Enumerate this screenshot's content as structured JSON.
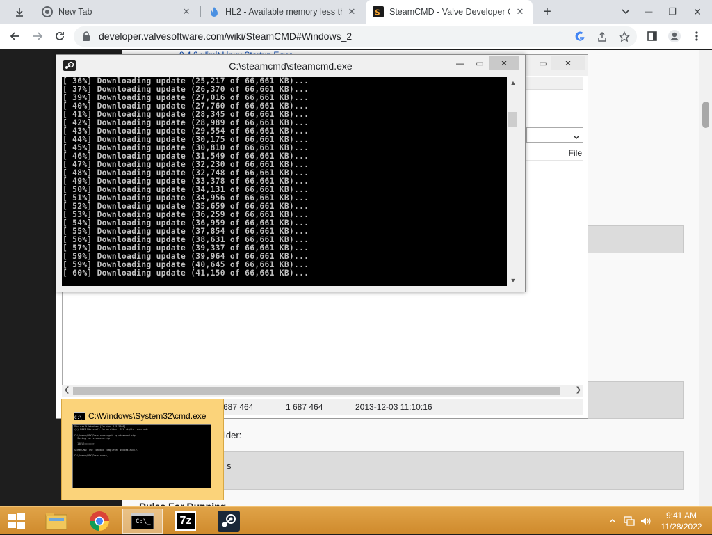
{
  "browser": {
    "tabs": [
      {
        "label": "New Tab",
        "icon": "chrome-icon"
      },
      {
        "label": "HL2 - Available memory less tha",
        "icon": "flame-icon"
      },
      {
        "label": "SteamCMD - Valve Developer Co",
        "icon": "valve-icon"
      }
    ],
    "new_tab_symbol": "+",
    "close_symbol": "✕",
    "url": "developer.valvesoftware.com/wiki/SteamCMD#Windows_2",
    "window_controls": {
      "minimize": "—",
      "restore": "❐",
      "close": "✕"
    }
  },
  "page": {
    "partial_text_top": "9.4.2 ulimit Linux Startup Error",
    "file_header": "File",
    "folder_text": "lder:",
    "s_text": "s",
    "bottom_text": "Rules For Running"
  },
  "explorer": {
    "status_size_a": "687 464",
    "status_size_b": "1 687 464",
    "status_date": "2013-12-03 11:10:16"
  },
  "cmd_window": {
    "title": "C:\\steamcmd\\steamcmd.exe",
    "lines": [
      "[ 36%] Downloading update (25,217 of 66,661 KB)...",
      "[ 37%] Downloading update (26,370 of 66,661 KB)...",
      "[ 39%] Downloading update (27,016 of 66,661 KB)...",
      "[ 40%] Downloading update (27,760 of 66,661 KB)...",
      "[ 41%] Downloading update (28,345 of 66,661 KB)...",
      "[ 42%] Downloading update (28,989 of 66,661 KB)...",
      "[ 43%] Downloading update (29,554 of 66,661 KB)...",
      "[ 44%] Downloading update (30,175 of 66,661 KB)...",
      "[ 45%] Downloading update (30,810 of 66,661 KB)...",
      "[ 46%] Downloading update (31,549 of 66,661 KB)...",
      "[ 47%] Downloading update (32,230 of 66,661 KB)...",
      "[ 48%] Downloading update (32,748 of 66,661 KB)...",
      "[ 49%] Downloading update (33,378 of 66,661 KB)...",
      "[ 50%] Downloading update (34,131 of 66,661 KB)...",
      "[ 51%] Downloading update (34,956 of 66,661 KB)...",
      "[ 52%] Downloading update (35,659 of 66,661 KB)...",
      "[ 53%] Downloading update (36,259 of 66,661 KB)...",
      "[ 54%] Downloading update (36,959 of 66,661 KB)...",
      "[ 55%] Downloading update (37,854 of 66,661 KB)...",
      "[ 56%] Downloading update (38,631 of 66,661 KB)...",
      "[ 57%] Downloading update (39,337 of 66,661 KB)...",
      "[ 59%] Downloading update (39,964 of 66,661 KB)...",
      "[ 59%] Downloading update (40,645 of 66,661 KB)...",
      "[ 60%] Downloading update (41,150 of 66,661 KB)..."
    ]
  },
  "preview": {
    "title": "C:\\Windows\\System32\\cmd.exe",
    "lines": [
      "Microsoft Windows [Version 6.3.9600]",
      "(c) 2013 Microsoft Corporation. All rights reserved.",
      "",
      "C:\\Users\\RPK\\Downloads>wget -q steamcmd.zip",
      "  Saving to: steamcmd.zip",
      "",
      "  100%[======>]",
      "",
      "SteamCMD: The command completed successfully.",
      "",
      "C:\\Users\\RPK\\Downloads>_"
    ]
  },
  "taskbar": {
    "apps": [
      {
        "name": "file-explorer",
        "icon": "folder-icon"
      },
      {
        "name": "chrome",
        "icon": "chrome-icon"
      },
      {
        "name": "command-prompt",
        "icon": "cmd-icon",
        "label": "C:\\_"
      },
      {
        "name": "7zip",
        "icon": "7zip-icon",
        "label": "7z"
      },
      {
        "name": "steam",
        "icon": "steam-icon"
      }
    ],
    "time": "9:41 AM",
    "date": "11/28/2022"
  }
}
